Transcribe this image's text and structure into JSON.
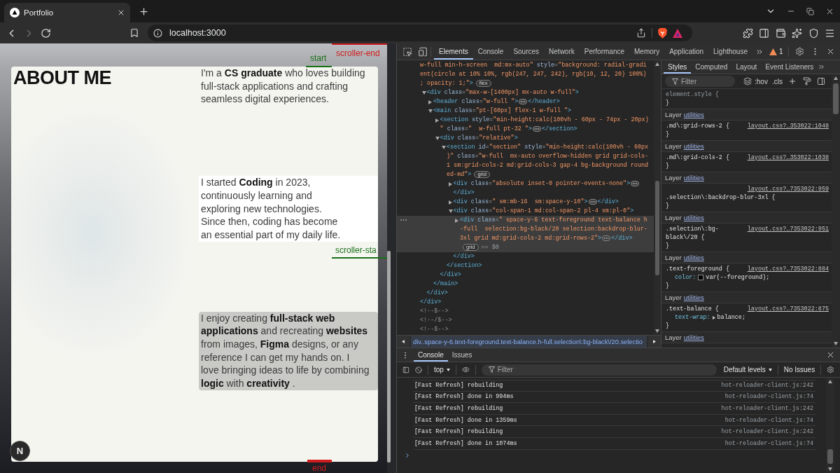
{
  "browser": {
    "tabs": [
      {
        "title": "Portfolio",
        "selected": true
      }
    ],
    "forward": {
      "disabled": true
    },
    "address_bar": {
      "url": "localhost:3000"
    }
  },
  "page": {
    "heading": "ABOUT ME",
    "paragraphs": [
      {
        "kind": "plain",
        "text": "I'm a **CS graduate** who loves building full-stack applications and crafting seamless digital experiences."
      },
      {
        "kind": "white",
        "text": "I started **Coding** in 2023, continuously learning and exploring new technologies. Since then, coding has become an essential part of my daily life."
      },
      {
        "kind": "shaded",
        "text": "I enjoy creating **full-stack web applications** and recreating **websites** from images, **Figma** designs, or any reference I can get my hands on. I love bringing ideas to life by combining **logic** with **creativity** ."
      }
    ],
    "markers": [
      {
        "label": "start",
        "color": "#177017"
      },
      {
        "label": "scroller-end",
        "color": "#d01c1c"
      },
      {
        "label": "scroller-sta",
        "color": "#177017"
      },
      {
        "label": "end",
        "color": "#d01c1c"
      }
    ],
    "dev_badge": {
      "label": "N"
    }
  },
  "devtools": {
    "tabs": [
      {
        "label": "Elements",
        "selected": true
      },
      {
        "label": "Console",
        "selected": false
      },
      {
        "label": "Sources",
        "selected": false
      },
      {
        "label": "Network",
        "selected": false
      },
      {
        "label": "Performance",
        "selected": false
      },
      {
        "label": "Memory",
        "selected": false
      },
      {
        "label": "Application",
        "selected": false
      },
      {
        "label": "Lighthouse",
        "selected": false
      }
    ],
    "warning_count": "1",
    "dom_tree": [
      {
        "kind": "element",
        "partial": true,
        "selected": false,
        "expanded": true,
        "open": "w-full min-h-screen  md:mx-auto\" style=\"background: radial-gradient(circle at 10% 10%, rgb(247, 247, 242), rgb(10, 12, 20) 100%); opacity: 1;\">",
        "badge": "flex",
        "close": "</div>",
        "children": [
          {
            "kind": "element",
            "selected": false,
            "expanded": true,
            "open": "<div class=\"max-w-[1400px] mx-auto w-full\">",
            "close": "</div>",
            "children": [
              {
                "kind": "element",
                "selected": false,
                "expanded": false,
                "open": "<header class=\"w-full \">",
                "close": "</header>"
              },
              {
                "kind": "element",
                "selected": false,
                "expanded": true,
                "open": "<main class=\"pt-[60px] flex-1 w-full \">",
                "close": "</main>",
                "children": [
                  {
                    "kind": "element",
                    "selected": false,
                    "expanded": false,
                    "open": "<section style=\"min-height:calc(100vh - 60px - 74px - 20px)\" class=\"  w-full pt-32 \">",
                    "close": "</section>"
                  },
                  {
                    "kind": "element",
                    "selected": false,
                    "expanded": true,
                    "open": "<div class=\"relative\">",
                    "close": "</div>",
                    "children": [
                      {
                        "kind": "element",
                        "selected": false,
                        "expanded": true,
                        "open": "<section id=\"section\" style=\"min-height:calc(100vh - 60px)\" class=\"w-full  mx-auto overflow-hidden grid grid-cols-1 sm:grid-cols-2 md:grid-cols-3 gap-4 bg-background rounded-md\">",
                        "badge": "grid",
                        "close": "</section>",
                        "children": [
                          {
                            "kind": "element",
                            "selected": false,
                            "expanded": false,
                            "open": "<div class=\"absolute inset-0 pointer-events-none\">",
                            "close": "</div>"
                          },
                          {
                            "kind": "element",
                            "selected": false,
                            "expanded": false,
                            "open": "<div class=\" sm:mb-16  sm:space-y-10\">",
                            "close": "</div>"
                          },
                          {
                            "kind": "element",
                            "selected": false,
                            "expanded": true,
                            "open": "<div class=\"col-span-1 md:col-span-2 pl-4 sm:pl-0\">",
                            "close": "</div>",
                            "children": [
                              {
                                "kind": "element",
                                "selected": true,
                                "expanded": false,
                                "open": "<div class=\" space-y-6 text-foreground text-balance h-full  selection:bg-black/20 selection:backdrop-blur-3xl grid md:grid-cols-2 md:grid-rows-2\">",
                                "close": "</div>",
                                "badge": "grid",
                                "suffix": "== $0"
                              }
                            ]
                          }
                        ]
                      }
                    ]
                  }
                ]
              }
            ]
          }
        ]
      },
      {
        "kind": "comment",
        "selected": false,
        "open": "<!--$-->"
      },
      {
        "kind": "comment",
        "selected": false,
        "open": "<!--/$-->"
      },
      {
        "kind": "comment",
        "selected": false,
        "open": "<!--$-->"
      }
    ],
    "breadcrumb": "div..space-y-6.text-foreground.text-balance.h-full.selection\\:bg-black\\/20.selectio",
    "styles": {
      "tabs": [
        {
          "label": "Styles",
          "selected": true
        },
        {
          "label": "Computed",
          "selected": false
        },
        {
          "label": "Layout",
          "selected": false
        },
        {
          "label": "Event Listeners",
          "selected": false
        }
      ],
      "filter": {
        "placeholder": "Filter"
      },
      "toggles": [
        ":hov",
        ".cls"
      ],
      "rules": [
        {
          "kind": "inline",
          "selector": "element.style {",
          "close": "}"
        },
        {
          "kind": "layer",
          "label": "Layer",
          "link": "utilities"
        },
        {
          "kind": "rule",
          "selector": ".md\\:grid-rows-2 {",
          "source": "layout.css?…353022:1048",
          "close": "}"
        },
        {
          "kind": "layer",
          "label": "Layer",
          "link": "utilities"
        },
        {
          "kind": "rule",
          "selector": ".md\\:grid-cols-2 {",
          "source": "layout.css?…353022:1038",
          "close": "}"
        },
        {
          "kind": "layer",
          "label": "Layer",
          "link": "utilities"
        },
        {
          "kind": "rule",
          "selector": ".selection\\:backdrop-blur-3xl {",
          "source": "layout.css?…7353022:959",
          "close": "}"
        },
        {
          "kind": "layer",
          "label": "Layer",
          "link": "utilities"
        },
        {
          "kind": "rule",
          "selector": ".selection\\:bg-black\\/20 {",
          "source": "layout.css?…7353022:951",
          "close": "}"
        },
        {
          "kind": "layer",
          "label": "Layer",
          "link": "utilities"
        },
        {
          "kind": "rule",
          "selector": ".text-foreground {",
          "source": "layout.css?…7353022:884",
          "declarations": [
            {
              "kind": "color",
              "property": "color:",
              "value": "var(--foreground);"
            }
          ],
          "close": "}"
        },
        {
          "kind": "layer",
          "label": "Layer",
          "link": "utilities"
        },
        {
          "kind": "rule",
          "selector": ".text-balance {",
          "source": "layout.css?…7353022:875",
          "declarations": [
            {
              "kind": "expandable",
              "property": "text-wrap:",
              "value": "balance;"
            }
          ],
          "close": "}"
        },
        {
          "kind": "layer",
          "label": "Layer",
          "link": "utilities"
        }
      ]
    },
    "drawer": {
      "tabs": [
        {
          "label": "Console",
          "selected": true
        },
        {
          "label": "Issues",
          "selected": false
        }
      ],
      "context": "top",
      "filter": {
        "placeholder": "Filter"
      },
      "levels": "Default levels",
      "issues": "No Issues",
      "messages": [
        {
          "text": "[Fast Refresh] rebuilding",
          "source": "hot-reloader-client.js:242"
        },
        {
          "text": "[Fast Refresh] done in 994ms",
          "source": "hot-reloader-client.js:74"
        },
        {
          "text": "[Fast Refresh] rebuilding",
          "source": "hot-reloader-client.js:242"
        },
        {
          "text": "[Fast Refresh] done in 1359ms",
          "source": "hot-reloader-client.js:74"
        },
        {
          "text": "[Fast Refresh] rebuilding",
          "source": "hot-reloader-client.js:242"
        },
        {
          "text": "[Fast Refresh] done in 1074ms",
          "source": "hot-reloader-client.js:74"
        }
      ]
    }
  }
}
